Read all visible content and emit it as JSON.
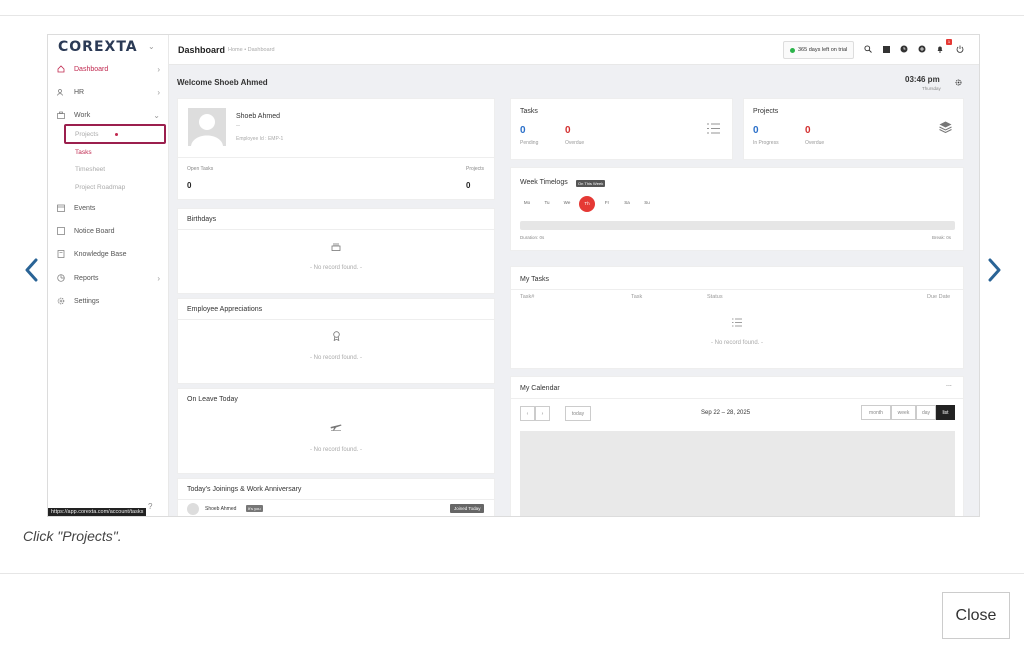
{
  "modal": {
    "caption": "Click \"Projects\".",
    "close_label": "Close"
  },
  "app": {
    "logo": "COREXTA",
    "sidebar": {
      "items": [
        {
          "label": "Dashboard",
          "icon": "home-icon"
        },
        {
          "label": "HR",
          "icon": "users-icon"
        },
        {
          "label": "Work",
          "icon": "briefcase-icon"
        },
        {
          "label": "Events",
          "icon": "calendar-icon"
        },
        {
          "label": "Notice Board",
          "icon": "notice-icon"
        },
        {
          "label": "Knowledge Base",
          "icon": "book-icon"
        },
        {
          "label": "Reports",
          "icon": "chart-icon"
        },
        {
          "label": "Settings",
          "icon": "gear-icon"
        }
      ],
      "work_sub": [
        "Projects",
        "Tasks",
        "Timesheet",
        "Project Roadmap"
      ]
    },
    "status_url": "https://app.corexta.com/account/tasks",
    "topbar": {
      "title": "Dashboard",
      "breadcrumb": "Home • Dashboard",
      "trial": "365 days left on trial",
      "notif_count": "1"
    },
    "welcome": "Welcome Shoeb Ahmed",
    "clock": {
      "time": "03:46 pm",
      "day": "Thursday"
    },
    "profile": {
      "name": "Shoeb Ahmed",
      "dash": "--",
      "employee_id": "Employee Id : EMP-1",
      "open_tasks_label": "Open Tasks",
      "open_tasks_value": "0",
      "projects_label": "Projects",
      "projects_value": "0"
    },
    "birthdays": {
      "title": "Birthdays",
      "empty": "- No record found. -"
    },
    "appreciations": {
      "title": "Employee Appreciations",
      "empty": "- No record found. -"
    },
    "on_leave": {
      "title": "On Leave Today",
      "empty": "- No record found. -"
    },
    "joinings": {
      "title": "Today's Joinings & Work Anniversary",
      "name": "Shoeb Ahmed",
      "tag": "It's you",
      "badge": "Joined Today"
    },
    "tasks_card": {
      "title": "Tasks",
      "pending_value": "0",
      "pending_label": "Pending",
      "overdue_value": "0",
      "overdue_label": "Overdue"
    },
    "projects_card": {
      "title": "Projects",
      "inprogress_value": "0",
      "inprogress_label": "In Progress",
      "overdue_value": "0",
      "overdue_label": "Overdue"
    },
    "week_timelogs": {
      "title": "Week Timelogs",
      "badge": "On This Week",
      "days": [
        "Mo",
        "Tu",
        "We",
        "Th",
        "Fr",
        "Sa",
        "Su"
      ],
      "today_index": 3,
      "duration": "Duration: 0s",
      "break": "Break: 0s",
      "progress_fraction": 0
    },
    "my_tasks": {
      "title": "My Tasks",
      "columns": [
        "Task#",
        "Task",
        "Status",
        "Due Date"
      ],
      "empty": "- No record found. -"
    },
    "calendar": {
      "title": "My Calendar",
      "more": "...",
      "today_label": "today",
      "range": "Sep 22 – 28, 2025",
      "views": [
        "month",
        "week",
        "day",
        "list"
      ],
      "active_view": "list"
    }
  }
}
